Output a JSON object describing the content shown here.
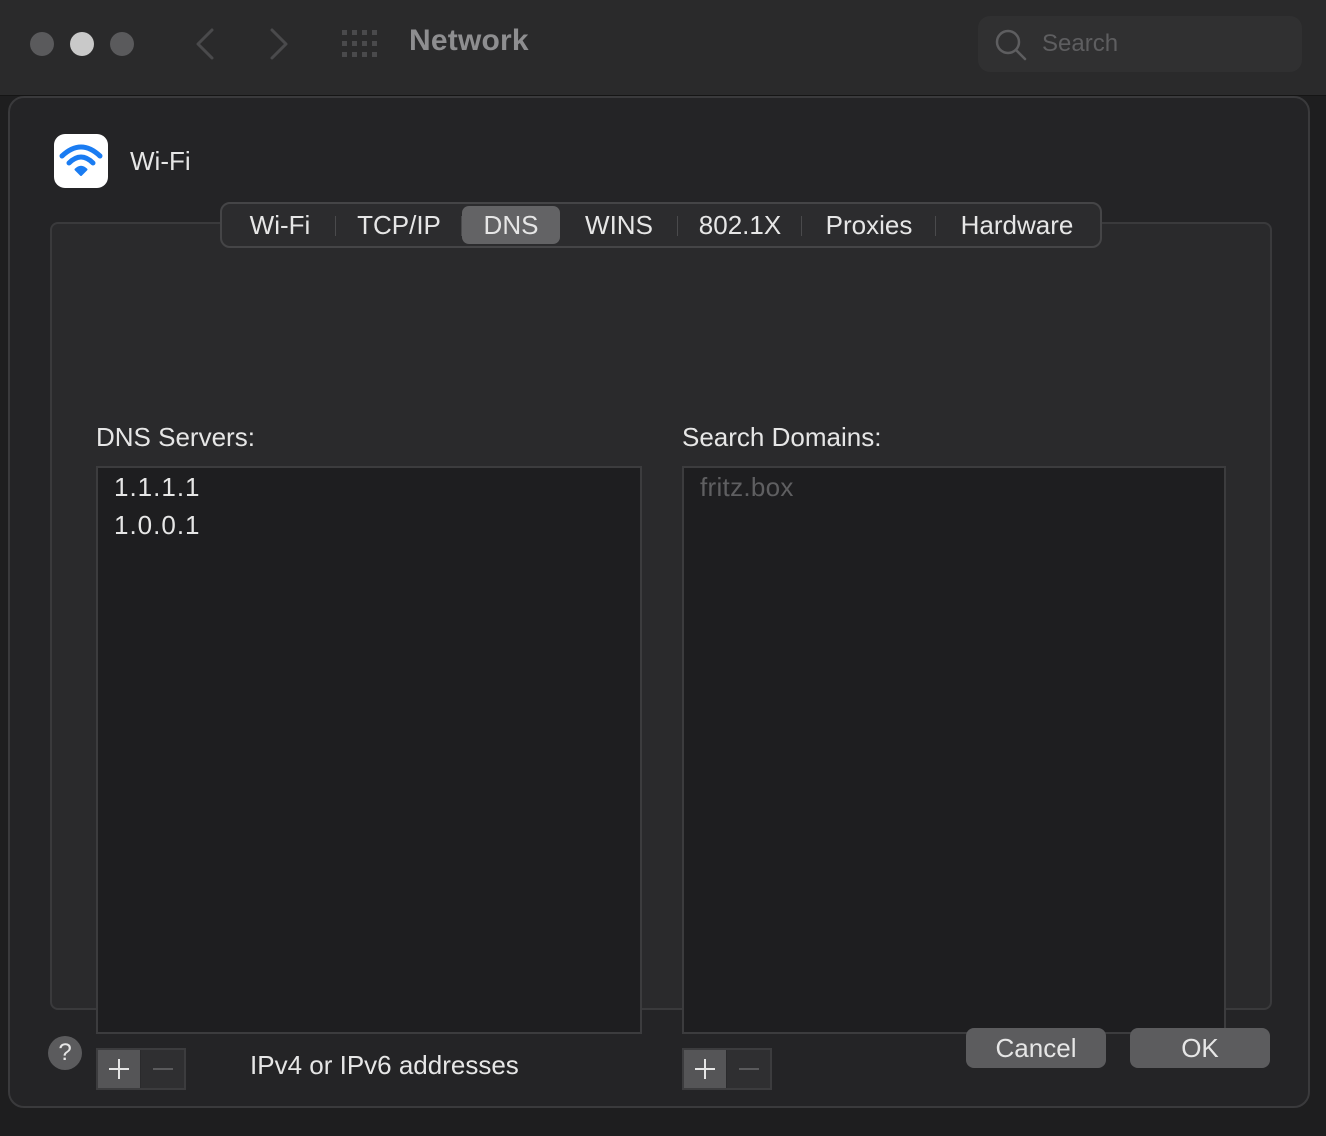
{
  "window": {
    "title": "Network",
    "search_placeholder": "Search"
  },
  "interface": {
    "name": "Wi-Fi",
    "icon": "wifi-icon",
    "accent": "#1a7cf2"
  },
  "tabs": [
    {
      "label": "Wi-Fi",
      "active": false
    },
    {
      "label": "TCP/IP",
      "active": false
    },
    {
      "label": "DNS",
      "active": true
    },
    {
      "label": "WINS",
      "active": false
    },
    {
      "label": "802.1X",
      "active": false
    },
    {
      "label": "Proxies",
      "active": false
    },
    {
      "label": "Hardware",
      "active": false
    }
  ],
  "dns": {
    "label": "DNS Servers:",
    "servers": [
      "1.1.1.1",
      "1.0.0.1"
    ],
    "hint": "IPv4 or IPv6 addresses"
  },
  "search_domains": {
    "label": "Search Domains:",
    "domains": [
      "fritz.box"
    ]
  },
  "buttons": {
    "help": "?",
    "cancel": "Cancel",
    "ok": "OK"
  }
}
